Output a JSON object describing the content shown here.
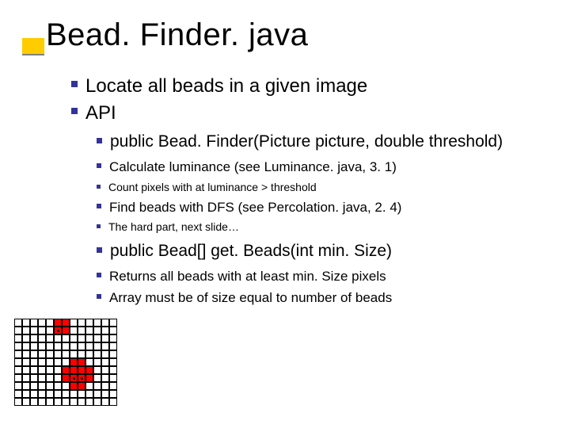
{
  "title": "Bead. Finder. java",
  "bullets": {
    "b1": "Locate all beads in a given image",
    "b2": "API",
    "b2a": "public Bead. Finder(Picture picture, double threshold)",
    "b2a1": "Calculate luminance (see Luminance. java, 3. 1)",
    "b2a1a": "Count pixels with at luminance > threshold",
    "b2a2": "Find beads with DFS (see Percolation. java, 2. 4)",
    "b2a2a": "The hard part, next slide…",
    "b2b": "public Bead[] get. Beads(int min. Size)",
    "b2b1": "Returns all beads with at least min. Size pixels",
    "b2b2": "Array must be of size equal to number of beads"
  },
  "figure": {
    "grid_cols": 13,
    "grid_rows": 11,
    "red_cells": [
      [
        5,
        0
      ],
      [
        6,
        0
      ],
      [
        5,
        1
      ],
      [
        6,
        1
      ],
      [
        7,
        5
      ],
      [
        8,
        5
      ],
      [
        6,
        6
      ],
      [
        7,
        6
      ],
      [
        8,
        6
      ],
      [
        9,
        6
      ],
      [
        6,
        7
      ],
      [
        7,
        7
      ],
      [
        8,
        7
      ],
      [
        9,
        7
      ],
      [
        7,
        8
      ],
      [
        8,
        8
      ]
    ],
    "dot_cells": [
      [
        5,
        1
      ],
      [
        7,
        7
      ],
      [
        8,
        7
      ]
    ]
  }
}
